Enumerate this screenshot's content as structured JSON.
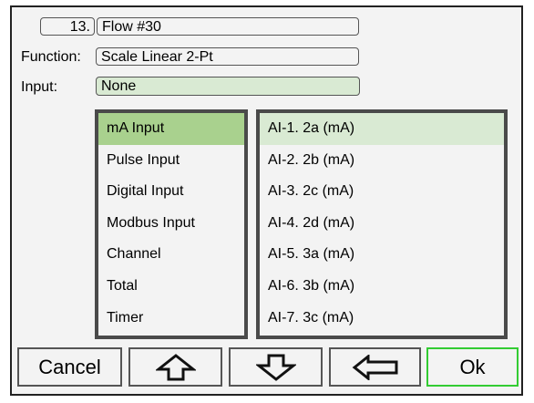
{
  "header": {
    "number": "13.",
    "name": "Flow #30",
    "function_label": "Function:",
    "function_value": "Scale Linear 2-Pt",
    "input_label": "Input:",
    "input_value": "None"
  },
  "left_list": {
    "items": [
      "mA Input",
      "Pulse Input",
      "Digital Input",
      "Modbus Input",
      "Channel",
      "Total",
      "Timer"
    ],
    "selected_index": 0
  },
  "right_list": {
    "items": [
      "AI-1. 2a (mA)",
      "AI-2. 2b (mA)",
      "AI-3. 2c (mA)",
      "AI-4. 2d (mA)",
      "AI-5. 3a (mA)",
      "AI-6. 3b (mA)",
      "AI-7. 3c (mA)"
    ],
    "selected_index": 0
  },
  "buttons": {
    "cancel": "Cancel",
    "up_icon": "up-arrow-icon",
    "down_icon": "down-arrow-icon",
    "left_icon": "left-arrow-icon",
    "ok": "Ok"
  },
  "colors": {
    "selected_primary": "#a9d18e",
    "selected_secondary": "#d9ead3",
    "input_field": "#d9ead3",
    "ok_border": "#33cc33"
  }
}
